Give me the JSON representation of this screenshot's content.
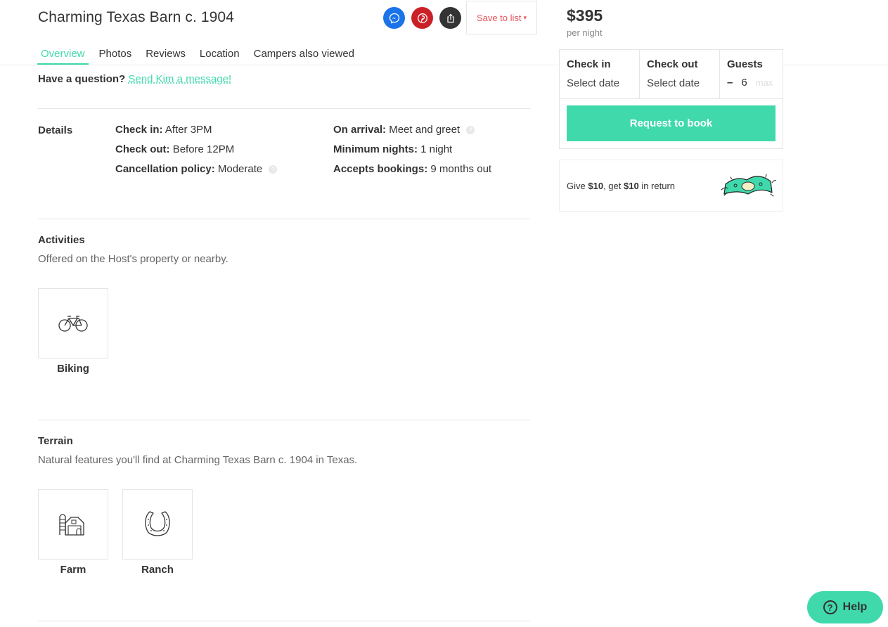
{
  "listing": {
    "title": "Charming Texas Barn c. 1904"
  },
  "share": {
    "messenger_icon": "messenger-icon",
    "pinterest_icon": "pinterest-icon",
    "share_icon": "share-icon",
    "save_label": "Save to list"
  },
  "tabs": [
    {
      "label": "Overview",
      "active": true
    },
    {
      "label": "Photos"
    },
    {
      "label": "Reviews"
    },
    {
      "label": "Location"
    },
    {
      "label": "Campers also viewed"
    }
  ],
  "question": {
    "prompt": "Have a question?",
    "link": "Send Kim a message!"
  },
  "details": {
    "label": "Details",
    "check_in_label": "Check in:",
    "check_in_value": "After 3PM",
    "check_out_label": "Check out:",
    "check_out_value": "Before 12PM",
    "cancellation_label": "Cancellation policy:",
    "cancellation_value": "Moderate",
    "arrival_label": "On arrival:",
    "arrival_value": "Meet and greet",
    "min_nights_label": "Minimum nights:",
    "min_nights_value": "1 night",
    "accepts_label": "Accepts bookings:",
    "accepts_value": "9 months out"
  },
  "activities": {
    "title": "Activities",
    "subtitle": "Offered on the Host's property or nearby.",
    "items": [
      {
        "label": "Biking",
        "icon": "bicycle-icon"
      }
    ]
  },
  "terrain": {
    "title": "Terrain",
    "subtitle": "Natural features you'll find at Charming Texas Barn c. 1904 in Texas.",
    "items": [
      {
        "label": "Farm",
        "icon": "farm-icon"
      },
      {
        "label": "Ranch",
        "icon": "horseshoe-icon"
      }
    ]
  },
  "booking": {
    "price": "$395",
    "per_night": "per night",
    "check_in_label": "Check in",
    "check_in_value": "Select date",
    "check_out_label": "Check out",
    "check_out_value": "Select date",
    "guests_label": "Guests",
    "guests_minus": "–",
    "guests_count": "6",
    "guests_max": "max",
    "request_label": "Request to book"
  },
  "referral": {
    "give": "Give",
    "give_amount": "$10",
    "get": ", get",
    "get_amount": "$10",
    "tail": "in return"
  },
  "help": {
    "label": "Help"
  },
  "colors": {
    "accent": "#40d9ac",
    "save_red": "#e5525a",
    "messenger_blue": "#1a73e8",
    "pinterest_red": "#cb2027"
  }
}
